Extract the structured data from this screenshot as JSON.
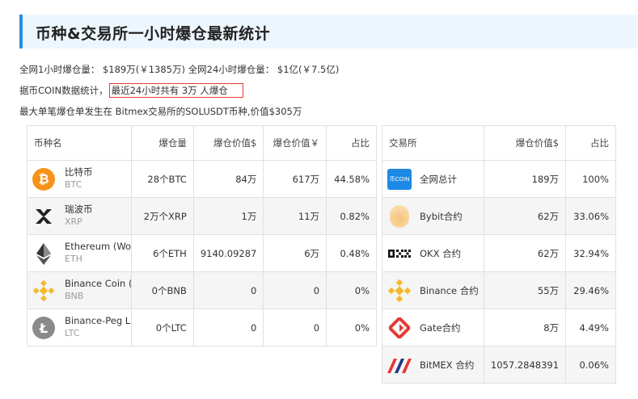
{
  "header": {
    "title": "币种&交易所一小时爆仓最新统计"
  },
  "summary": {
    "line1": "全网1小时爆仓量： $189万(￥1385万) 全网24小时爆仓量： $1亿(￥7.5亿)",
    "line2_prefix": "据币COIN数据统计，",
    "line2_boxed": "最近24小时共有 3万 人爆仓",
    "line3": "最大单笔爆仓单发生在 Bitmex交易所的SOLUSDT币种,价值$305万"
  },
  "coin_table": {
    "headers": [
      "币种名",
      "爆仓量",
      "爆仓价值$",
      "爆仓价值￥",
      "占比"
    ],
    "rows": [
      {
        "name": "比特币",
        "symbol": "BTC",
        "icon": "bitcoin-icon",
        "amount": "28个BTC",
        "usd": "84万",
        "cny": "617万",
        "pct": "44.58%",
        "color": "#f7931a"
      },
      {
        "name": "瑞波币",
        "symbol": "XRP",
        "icon": "xrp-icon",
        "amount": "2万个XRP",
        "usd": "1万",
        "cny": "11万",
        "pct": "0.82%",
        "color": "#222222"
      },
      {
        "name": "Ethereum (Wor",
        "symbol": "ETH",
        "icon": "ethereum-icon",
        "amount": "6个ETH",
        "usd": "9140.09287",
        "cny": "6万",
        "pct": "0.48%",
        "color": "#343434"
      },
      {
        "name": "Binance Coin (V",
        "symbol": "BNB",
        "icon": "bnb-icon",
        "amount": "0个BNB",
        "usd": "0",
        "cny": "0",
        "pct": "0%",
        "color": "#f3ba2f"
      },
      {
        "name": "Binance-Peg Lit",
        "symbol": "LTC",
        "icon": "litecoin-icon",
        "amount": "0个LTC",
        "usd": "0",
        "cny": "0",
        "pct": "0%",
        "color": "#8a8a8a"
      }
    ]
  },
  "exchange_table": {
    "headers": [
      "交易所",
      "爆仓价值$",
      "占比"
    ],
    "rows": [
      {
        "name": "全网总计",
        "icon": "bicoin-logo-icon",
        "usd": "189万",
        "pct": "100%",
        "logo_text": "币COIN"
      },
      {
        "name": "Bybit合约",
        "icon": "bybit-icon",
        "usd": "62万",
        "pct": "33.06%"
      },
      {
        "name": "OKX 合约",
        "icon": "okx-icon",
        "usd": "62万",
        "pct": "32.94%"
      },
      {
        "name": "Binance 合约",
        "icon": "binance-icon",
        "usd": "55万",
        "pct": "29.46%"
      },
      {
        "name": "Gate合约",
        "icon": "gate-icon",
        "usd": "8万",
        "pct": "4.49%"
      },
      {
        "name": "BitMEX 合约",
        "icon": "bitmex-icon",
        "usd": "1057.2848391",
        "pct": "0.06%"
      }
    ]
  }
}
